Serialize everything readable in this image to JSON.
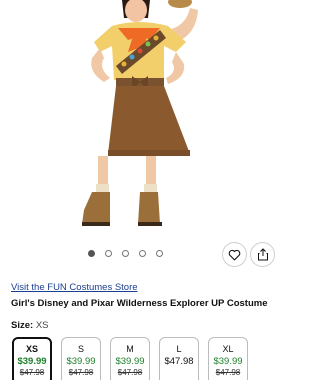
{
  "product_image": {
    "alt": "Girl's Disney and Pixar Wilderness Explorer UP Costume"
  },
  "carousel": {
    "count": 5,
    "active": 0
  },
  "actions": {
    "favorite_icon": "heart-icon",
    "share_icon": "share-icon"
  },
  "store_link": "Visit the FUN Costumes Store",
  "product_title": "Girl's Disney and Pixar Wilderness Explorer UP Costume",
  "size_selector": {
    "label": "Size:",
    "selected": "XS"
  },
  "sizes": [
    {
      "name": "XS",
      "price": "$39.99",
      "was": "$47.98",
      "sale": true
    },
    {
      "name": "S",
      "price": "$39.99",
      "was": "$47.98",
      "sale": true
    },
    {
      "name": "M",
      "price": "$39.99",
      "was": "$47.98",
      "sale": true
    },
    {
      "name": "L",
      "price": "$47.98",
      "was": "",
      "sale": false
    },
    {
      "name": "XL",
      "price": "$39.99",
      "was": "$47.98",
      "sale": true
    }
  ],
  "colors": {
    "sale_green": "#1d7f2a",
    "link_blue": "#1b3f8f"
  }
}
